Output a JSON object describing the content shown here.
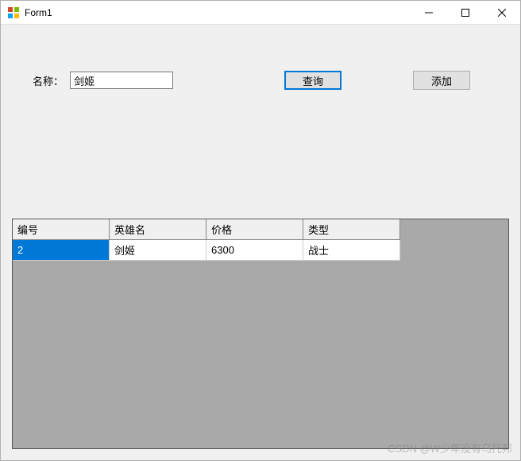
{
  "window": {
    "title": "Form1"
  },
  "form": {
    "name_label": "名称：",
    "name_value": "剑姬",
    "query_button": "查询",
    "add_button": "添加"
  },
  "grid": {
    "columns": [
      "编号",
      "英雄名",
      "价格",
      "类型"
    ],
    "rows": [
      {
        "id": "2",
        "name": "剑姬",
        "price": "6300",
        "type": "战士",
        "selected_col": 0
      }
    ]
  },
  "watermark": "CSDN @W少年没有乌托邦"
}
